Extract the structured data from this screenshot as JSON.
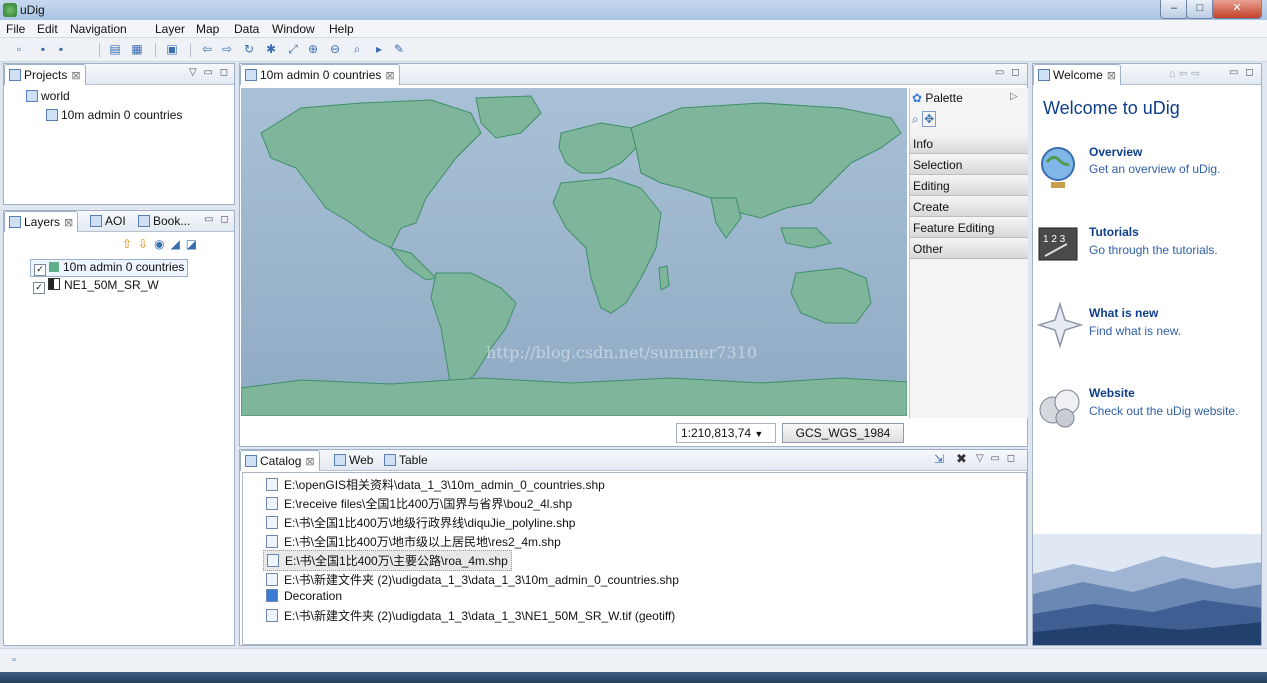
{
  "window": {
    "title": "uDig",
    "controls": [
      "–",
      "□",
      "✕"
    ]
  },
  "menu": [
    "File",
    "Edit",
    "Navigation",
    "Layer",
    "Map",
    "Data",
    "Window",
    "Help"
  ],
  "projects": {
    "tab": "Projects",
    "tree": [
      {
        "label": "world"
      },
      {
        "label": "10m admin 0 countries"
      }
    ]
  },
  "layers": {
    "tabs": [
      "Layers",
      "AOI",
      "Book..."
    ],
    "items": [
      {
        "label": "10m admin 0 countries",
        "checked": "✓"
      },
      {
        "label": "NE1_50M_SR_W",
        "checked": "✓"
      }
    ]
  },
  "map": {
    "tab": "10m admin 0 countries",
    "scale": "1:210,813,74",
    "crs": "GCS_WGS_1984",
    "watermark": "http://blog.csdn.net/summer7310"
  },
  "palette": {
    "title": "Palette",
    "items": [
      "Info",
      "Selection",
      "Editing",
      "Create",
      "Feature Editing",
      "Other"
    ]
  },
  "catalog": {
    "tabs": [
      "Catalog",
      "Web",
      "Table"
    ],
    "items": [
      "E:\\openGIS相关资料\\data_1_3\\10m_admin_0_countries.shp",
      "E:\\receive files\\全国1比400万\\国界与省界\\bou2_4l.shp",
      "E:\\书\\全国1比400万\\地级行政界线\\diquJie_polyline.shp",
      "E:\\书\\全国1比400万\\地市级以上居民地\\res2_4m.shp",
      "E:\\书\\全国1比400万\\主要公路\\roa_4m.shp",
      "E:\\书\\新建文件夹 (2)\\udigdata_1_3\\data_1_3\\10m_admin_0_countries.shp",
      "Decoration",
      "E:\\书\\新建文件夹 (2)\\udigdata_1_3\\data_1_3\\NE1_50M_SR_W.tif (geotiff)"
    ]
  },
  "welcome": {
    "tab": "Welcome",
    "heading": "Welcome to uDig",
    "sections": [
      {
        "title": "Overview",
        "desc": "Get an overview of uDig."
      },
      {
        "title": "Tutorials",
        "desc": "Go through the tutorials."
      },
      {
        "title": "What is new",
        "desc": "Find what is new."
      },
      {
        "title": "Website",
        "desc": "Check out the uDig website."
      }
    ]
  }
}
